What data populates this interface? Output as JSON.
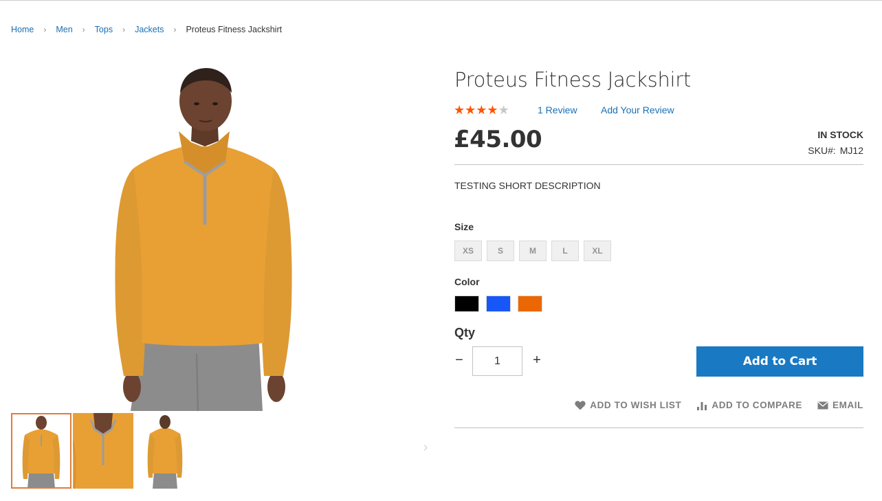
{
  "breadcrumb": {
    "items": [
      "Home",
      "Men",
      "Tops",
      "Jackets"
    ],
    "current": "Proteus Fitness Jackshirt"
  },
  "product": {
    "title": "Proteus Fitness Jackshirt",
    "rating_stars": 4,
    "rating_max": 5,
    "review_count_label": "1 Review",
    "add_review_label": "Add Your Review",
    "price": "£45.00",
    "stock_status": "IN STOCK",
    "sku_label": "SKU#:",
    "sku_value": "MJ12",
    "short_description": "TESTING SHORT DESCRIPTION"
  },
  "options": {
    "size_label": "Size",
    "sizes": [
      "XS",
      "S",
      "M",
      "L",
      "XL"
    ],
    "color_label": "Color",
    "colors": [
      "#000000",
      "#1857f7",
      "#eb6703"
    ]
  },
  "qty": {
    "label": "Qty",
    "value": "1",
    "minus_symbol": "−",
    "plus_symbol": "+"
  },
  "cart": {
    "add_to_cart_label": "Add to Cart"
  },
  "actions": {
    "wishlist_label": "ADD TO WISH LIST",
    "compare_label": "ADD TO COMPARE",
    "email_label": "EMAIL"
  },
  "gallery": {
    "thumbnail_count": 3,
    "active_thumbnail": 1,
    "next_arrow": "›"
  },
  "theme": {
    "link_color": "#1a6fb5",
    "button_color": "#1979c3",
    "star_color": "#ff5501",
    "product_color": "#e8a035"
  }
}
